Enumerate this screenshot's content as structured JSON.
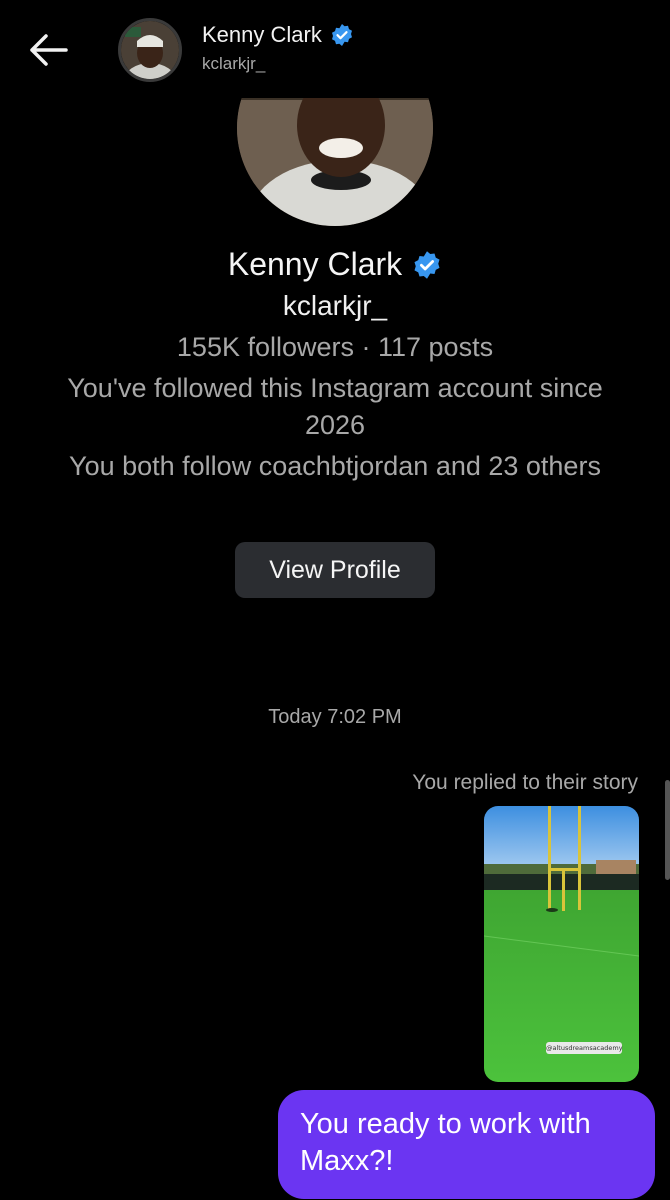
{
  "header": {
    "name": "Kenny Clark",
    "handle": "kclarkjr_",
    "verified": true,
    "back_icon": "arrow-left-icon"
  },
  "profile": {
    "name": "Kenny Clark",
    "handle": "kclarkjr_",
    "stats": "155K followers · 117 posts",
    "follow_since": "You've followed this Instagram account since 2026",
    "mutual": "You both follow coachbtjordan and 23 others",
    "view_profile_label": "View Profile"
  },
  "conversation": {
    "timestamp": "Today 7:02 PM",
    "story_reply_note": "You replied to their story",
    "story_tag": "@altusdreamsacademy",
    "message": "You ready to work with Maxx?!"
  },
  "colors": {
    "background": "#000000",
    "bubble": "#6b35f2",
    "verified": "#3897f0",
    "secondary_text": "#a8a8a8",
    "button": "#2b2d31"
  }
}
